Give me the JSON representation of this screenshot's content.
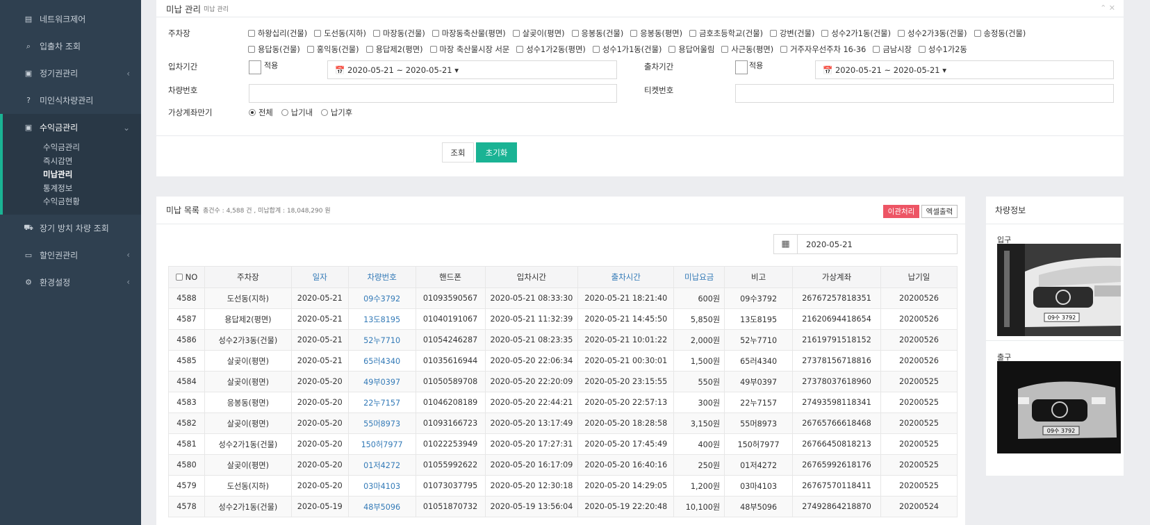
{
  "sidebar": {
    "items": [
      {
        "icon": "chart-icon",
        "glyph": "▤",
        "label": "네트워크제어"
      },
      {
        "icon": "search-icon",
        "glyph": "⌕",
        "label": "입출차 조회"
      },
      {
        "icon": "money-icon",
        "glyph": "▣",
        "label": "정기권관리",
        "chevron": "‹"
      },
      {
        "icon": "question-icon",
        "glyph": "?",
        "label": "미인식차량관리"
      }
    ],
    "group": {
      "icon": "money-icon",
      "glyph": "▣",
      "label": "수익금관리",
      "chevron": "⌄",
      "subitems": [
        "수익금관리",
        "즉시감면",
        "미납관리",
        "통계정보",
        "수익금현황"
      ],
      "active_index": 2
    },
    "items_after": [
      {
        "icon": "car-icon",
        "glyph": "⛟",
        "label": "장기 방치 차량 조회"
      },
      {
        "icon": "card-icon",
        "glyph": "▭",
        "label": "할인권관리",
        "chevron": "‹"
      },
      {
        "icon": "gear-icon",
        "glyph": "⚙",
        "label": "환경설정",
        "chevron": "‹"
      }
    ]
  },
  "search_panel": {
    "title": "미납 관리",
    "subtitle": "미납 관리",
    "tools": "⌃ ✕",
    "parking_label": "주차장",
    "parking_lots": [
      "하왕십리(건물)",
      "도선동(지하)",
      "마장동(건물)",
      "마장동축산물(평면)",
      "살곶이(평면)",
      "응봉동(건물)",
      "응봉동(평면)",
      "금호초등학교(건물)",
      "강변(건물)",
      "성수2가1동(건물)",
      "성수2가3동(건물)",
      "송정동(건물)",
      "용답동(건물)",
      "홍익동(건물)",
      "용답제2(평면)",
      "마장 축산물시장 서문",
      "성수1가2동(평면)",
      "성수1가1동(건물)",
      "용답어울림",
      "사근동(평면)",
      "거주자우선주차 16-36",
      "금남시장",
      "성수1가2동"
    ],
    "entry_period_label": "입차기간",
    "apply_label": "적용",
    "entry_range": "📅 2020-05-21 ~ 2020-05-21 ▾",
    "exit_period_label": "출차기간",
    "exit_range": "📅 2020-05-21 ~ 2020-05-21 ▾",
    "vehicle_no_label": "차량번호",
    "ticket_no_label": "티켓번호",
    "vaccount_label": "가상계좌만기",
    "radio_options": [
      "전체",
      "납기내",
      "납기후"
    ],
    "radio_selected": 0,
    "search_button": "조회",
    "reset_button": "초기화"
  },
  "list_panel": {
    "title": "미납 목록",
    "summary": "총건수 : 4,588 건 , 미납합계 : 18,048,290 원",
    "transfer_button": "이관처리",
    "excel_button": "엑셀출력",
    "calendar_icon": "▦",
    "date_value": "2020-05-21",
    "columns": [
      "NO",
      "주차장",
      "일자",
      "차량번호",
      "핸드폰",
      "입차시간",
      "출차시간",
      "미납요금",
      "비고",
      "가상계좌",
      "납기일"
    ],
    "rows": [
      [
        "4588",
        "도선동(지하)",
        "2020-05-21",
        "09수3792",
        "01093590567",
        "2020-05-21 08:33:30",
        "2020-05-21 18:21:40",
        "600원",
        "09수3792",
        "26767257818351",
        "20200526"
      ],
      [
        "4587",
        "용답제2(평면)",
        "2020-05-21",
        "13도8195",
        "01040191067",
        "2020-05-21 11:32:39",
        "2020-05-21 14:45:50",
        "5,850원",
        "13도8195",
        "21620694418654",
        "20200526"
      ],
      [
        "4586",
        "성수2가3동(건물)",
        "2020-05-21",
        "52누7710",
        "01054246287",
        "2020-05-21 08:23:35",
        "2020-05-21 10:01:22",
        "2,000원",
        "52누7710",
        "21619791518152",
        "20200526"
      ],
      [
        "4585",
        "살곶이(평면)",
        "2020-05-21",
        "65러4340",
        "01035616944",
        "2020-05-20 22:06:34",
        "2020-05-21 00:30:01",
        "1,500원",
        "65러4340",
        "27378156718816",
        "20200526"
      ],
      [
        "4584",
        "살곶이(평면)",
        "2020-05-20",
        "49부0397",
        "01050589708",
        "2020-05-20 22:20:09",
        "2020-05-20 23:15:55",
        "550원",
        "49부0397",
        "27378037618960",
        "20200525"
      ],
      [
        "4583",
        "응봉동(평면)",
        "2020-05-20",
        "22누7157",
        "01046208189",
        "2020-05-20 22:44:21",
        "2020-05-20 22:57:13",
        "300원",
        "22누7157",
        "27493598118341",
        "20200525"
      ],
      [
        "4582",
        "살곶이(평면)",
        "2020-05-20",
        "55머8973",
        "01093166723",
        "2020-05-20 13:17:49",
        "2020-05-20 18:28:58",
        "3,150원",
        "55머8973",
        "26765766618468",
        "20200525"
      ],
      [
        "4581",
        "성수2가1동(건물)",
        "2020-05-20",
        "150허7977",
        "01022253949",
        "2020-05-20 17:27:31",
        "2020-05-20 17:45:49",
        "400원",
        "150허7977",
        "26766450818213",
        "20200525"
      ],
      [
        "4580",
        "살곶이(평면)",
        "2020-05-20",
        "01저4272",
        "01055992622",
        "2020-05-20 16:17:09",
        "2020-05-20 16:40:16",
        "250원",
        "01저4272",
        "26765992618176",
        "20200525"
      ],
      [
        "4579",
        "도선동(지하)",
        "2020-05-20",
        "03마4103",
        "01073037795",
        "2020-05-20 12:30:18",
        "2020-05-20 14:29:05",
        "1,200원",
        "03마4103",
        "26767570118411",
        "20200525"
      ],
      [
        "4578",
        "성수2가1동(건물)",
        "2020-05-19",
        "48부5096",
        "01051870732",
        "2020-05-19 13:56:04",
        "2020-05-19 22:20:48",
        "10,100원",
        "48부5096",
        "27492864218870",
        "20200524"
      ]
    ]
  },
  "vehicle_panel": {
    "title": "차량정보",
    "entry_label": "입구",
    "exit_label": "출구",
    "entry_plate": "09수 3792",
    "exit_plate": "09수 3792"
  }
}
